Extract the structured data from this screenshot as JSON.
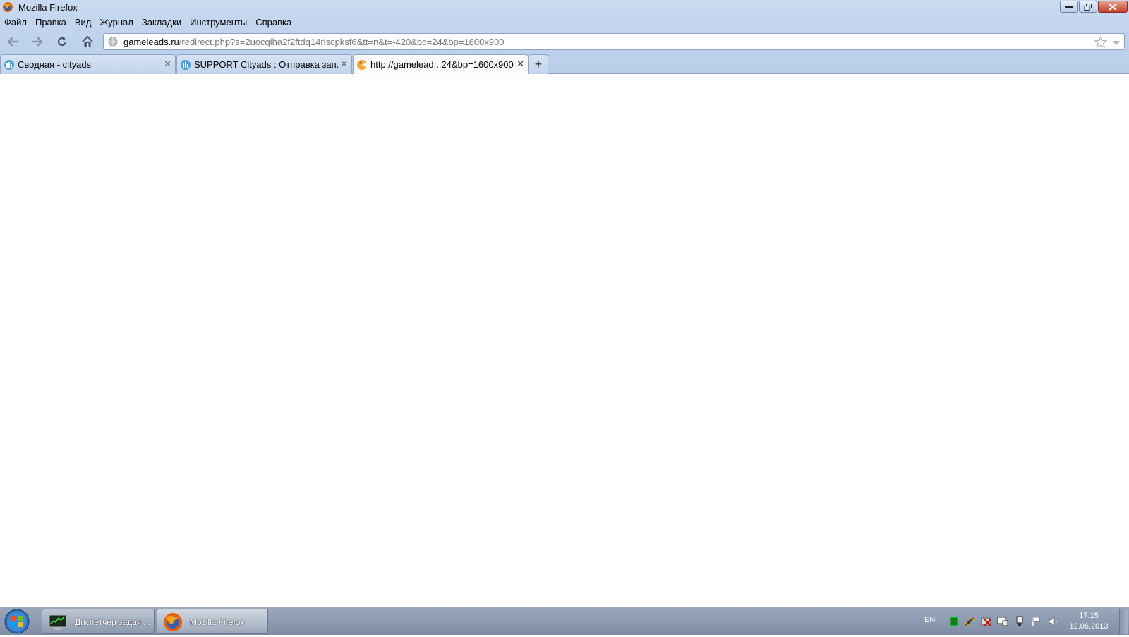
{
  "window": {
    "title": "Mozilla Firefox"
  },
  "menubar": {
    "items": [
      "Файл",
      "Правка",
      "Вид",
      "Журнал",
      "Закладки",
      "Инструменты",
      "Справка"
    ]
  },
  "navbar": {
    "url_host": "gameleads.ru",
    "url_rest": "/redirect.php?s=2uocqiha2f2ftdq14riscpksf6&tt=n&t=-420&bc=24&bp=1600x900"
  },
  "tabs": [
    {
      "label": "Сводная - cityads",
      "active": false
    },
    {
      "label": "SUPPORT Cityads : Отправка зап...",
      "active": false
    },
    {
      "label": "http://gamelead...24&bp=1600x900",
      "active": true
    }
  ],
  "taskbar": {
    "apps": [
      {
        "label": "Диспетчер задач ...",
        "icon": "task-manager-icon",
        "active": false
      },
      {
        "label": "Mozilla Firefox",
        "icon": "firefox-icon",
        "active": true
      }
    ],
    "language": "EN",
    "time": "17:15",
    "date": "12.06.2013"
  },
  "colors": {
    "chrome": "#c9daf0",
    "taskbar": "#8a98ad",
    "close_button": "#c0412c"
  }
}
